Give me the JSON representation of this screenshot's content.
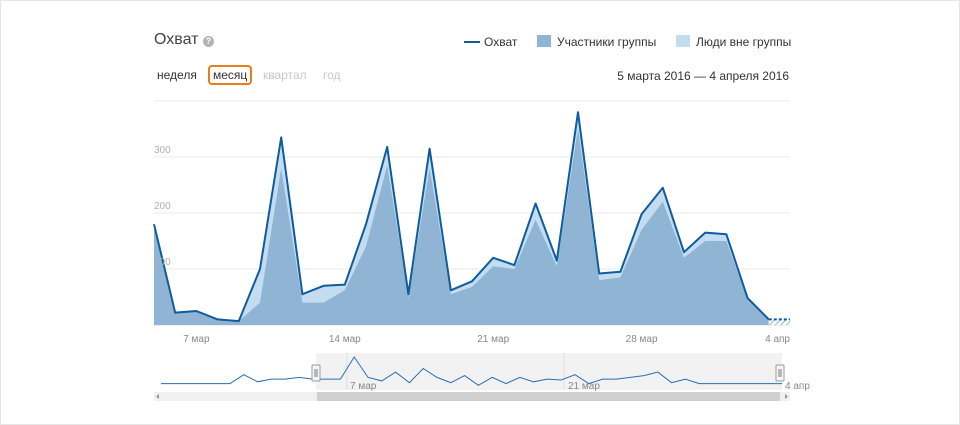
{
  "header": {
    "title": "Охват",
    "help_icon": "question-icon"
  },
  "legend": [
    {
      "label": "Охват",
      "kind": "line",
      "color": "#0e5c9c"
    },
    {
      "label": "Участники группы",
      "kind": "area",
      "color": "#8fb4d4"
    },
    {
      "label": "Люди вне группы",
      "kind": "area",
      "color": "#c3dcf0"
    }
  ],
  "periods": [
    {
      "label": "неделя",
      "state": "normal"
    },
    {
      "label": "месяц",
      "state": "active"
    },
    {
      "label": "квартал",
      "state": "disabled"
    },
    {
      "label": "год",
      "state": "disabled"
    }
  ],
  "date_range": "5 марта 2016 — 4 апреля 2016",
  "chart_data": {
    "type": "area",
    "x": [
      "5 мар",
      "6 мар",
      "7 мар",
      "8 мар",
      "9 мар",
      "10 мар",
      "11 мар",
      "12 мар",
      "13 мар",
      "14 мар",
      "15 мар",
      "16 мар",
      "17 мар",
      "18 мар",
      "19 мар",
      "20 мар",
      "21 мар",
      "22 мар",
      "23 мар",
      "24 мар",
      "25 мар",
      "26 мар",
      "27 мар",
      "28 мар",
      "29 мар",
      "30 мар",
      "31 мар",
      "1 апр",
      "2 апр",
      "3 апр",
      "4 апр"
    ],
    "series": [
      {
        "name": "Охват",
        "values": [
          180,
          22,
          25,
          10,
          7,
          100,
          335,
          55,
          70,
          72,
          180,
          318,
          55,
          315,
          62,
          78,
          120,
          107,
          217,
          115,
          380,
          92,
          95,
          198,
          245,
          130,
          165,
          162,
          48,
          10,
          10
        ]
      },
      {
        "name": "Участники группы",
        "values": [
          180,
          22,
          25,
          10,
          7,
          40,
          280,
          40,
          40,
          62,
          140,
          285,
          48,
          280,
          55,
          68,
          105,
          100,
          188,
          105,
          350,
          80,
          85,
          170,
          220,
          120,
          150,
          150,
          45,
          8,
          8
        ]
      },
      {
        "name": "Люди вне группы",
        "values": [
          0,
          0,
          0,
          0,
          0,
          60,
          55,
          15,
          30,
          10,
          40,
          33,
          7,
          35,
          7,
          10,
          15,
          7,
          29,
          10,
          30,
          12,
          10,
          28,
          25,
          10,
          15,
          12,
          3,
          2,
          2
        ]
      }
    ],
    "y_ticks": [
      "100",
      "200",
      "300"
    ],
    "ylim": [
      0,
      400
    ],
    "x_ticks": [
      {
        "x": "7 мар",
        "label": "7 мар"
      },
      {
        "x": "14 мар",
        "label": "14 мар"
      },
      {
        "x": "21 мар",
        "label": "21 мар"
      },
      {
        "x": "28 мар",
        "label": "28 мар"
      },
      {
        "x": "4 апр",
        "label": "4 апр"
      }
    ],
    "grid": true,
    "legend_position": "top-right"
  },
  "navigator": {
    "tick_labels": [
      "7 мар",
      "21 мар",
      "4 апр"
    ],
    "series": [
      5,
      5,
      5,
      5,
      5,
      5,
      15,
      7,
      10,
      10,
      12,
      10,
      10,
      10,
      35,
      12,
      8,
      18,
      6,
      22,
      12,
      6,
      14,
      3,
      12,
      5,
      12,
      7,
      10,
      9,
      15,
      5,
      10,
      10,
      12,
      14,
      18,
      6,
      10,
      5,
      5,
      5,
      5,
      5,
      5,
      5
    ],
    "selection": [
      0.25,
      1.0
    ]
  }
}
